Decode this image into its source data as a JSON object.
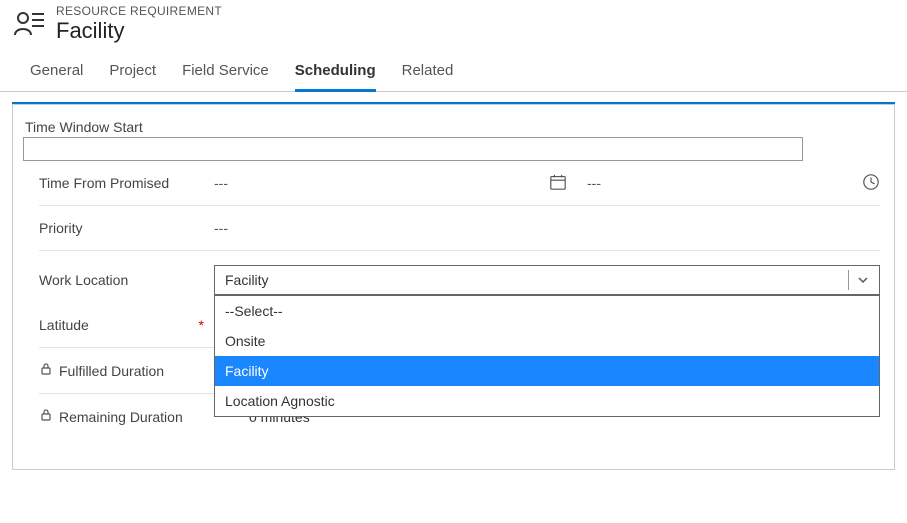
{
  "header": {
    "subtitle": "RESOURCE REQUIREMENT",
    "title": "Facility"
  },
  "tabs": {
    "items": [
      {
        "label": "General"
      },
      {
        "label": "Project"
      },
      {
        "label": "Field Service"
      },
      {
        "label": "Scheduling"
      },
      {
        "label": "Related"
      }
    ],
    "active_index": 3
  },
  "form": {
    "time_window_start_label": "Time Window Start",
    "time_window_start_value": "",
    "time_from_promised_label": "Time From Promised",
    "time_from_promised_value": "---",
    "time_from_promised_date": "---",
    "priority_label": "Priority",
    "priority_value": "---",
    "work_location": {
      "label": "Work Location",
      "selected": "Facility",
      "options": [
        "--Select--",
        "Onsite",
        "Facility",
        "Location Agnostic"
      ],
      "highlighted_index": 2
    },
    "latitude_label": "Latitude",
    "fulfilled_duration_label": "Fulfilled Duration",
    "remaining_duration_label": "Remaining Duration",
    "remaining_duration_value": "0 minutes"
  }
}
